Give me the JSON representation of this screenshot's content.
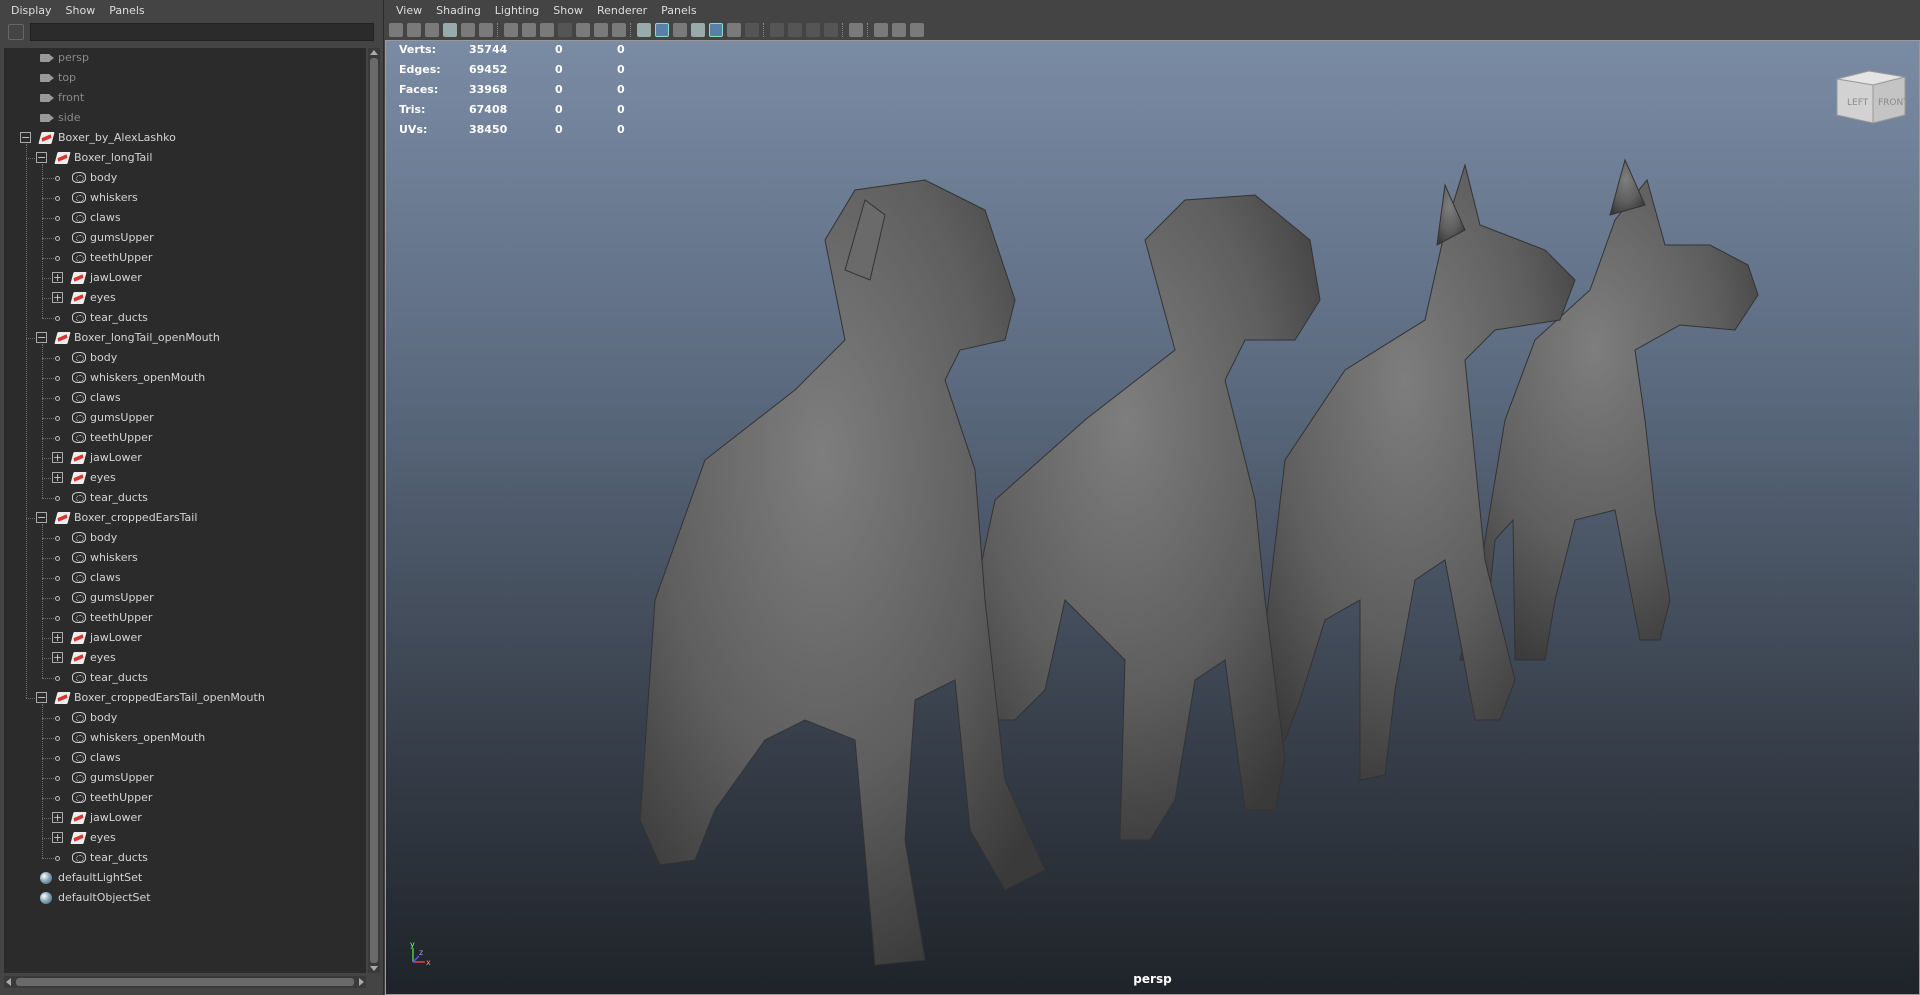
{
  "outliner": {
    "menu": [
      "Display",
      "Show",
      "Panels"
    ],
    "items": [
      {
        "label": "persp",
        "type": "camera",
        "level": 0
      },
      {
        "label": "top",
        "type": "camera",
        "level": 0
      },
      {
        "label": "front",
        "type": "camera",
        "level": 0
      },
      {
        "label": "side",
        "type": "camera",
        "level": 0
      },
      {
        "label": "Boxer_by_AlexLashko",
        "type": "group",
        "level": 0,
        "expand": "minus"
      },
      {
        "label": "Boxer_longTail",
        "type": "group",
        "level": 1,
        "expand": "minus"
      },
      {
        "label": "body",
        "type": "mesh",
        "level": 2
      },
      {
        "label": "whiskers",
        "type": "mesh",
        "level": 2
      },
      {
        "label": "claws",
        "type": "mesh",
        "level": 2
      },
      {
        "label": "gumsUpper",
        "type": "mesh",
        "level": 2
      },
      {
        "label": "teethUpper",
        "type": "mesh",
        "level": 2
      },
      {
        "label": "jawLower",
        "type": "group",
        "level": 2,
        "expand": "plus"
      },
      {
        "label": "eyes",
        "type": "group",
        "level": 2,
        "expand": "plus"
      },
      {
        "label": "tear_ducts",
        "type": "mesh",
        "level": 2
      },
      {
        "label": "Boxer_longTail_openMouth",
        "type": "group",
        "level": 1,
        "expand": "minus"
      },
      {
        "label": "body",
        "type": "mesh",
        "level": 2
      },
      {
        "label": "whiskers_openMouth",
        "type": "mesh",
        "level": 2
      },
      {
        "label": "claws",
        "type": "mesh",
        "level": 2
      },
      {
        "label": "gumsUpper",
        "type": "mesh",
        "level": 2
      },
      {
        "label": "teethUpper",
        "type": "mesh",
        "level": 2
      },
      {
        "label": "jawLower",
        "type": "group",
        "level": 2,
        "expand": "plus"
      },
      {
        "label": "eyes",
        "type": "group",
        "level": 2,
        "expand": "plus"
      },
      {
        "label": "tear_ducts",
        "type": "mesh",
        "level": 2
      },
      {
        "label": "Boxer_croppedEarsTail",
        "type": "group",
        "level": 1,
        "expand": "minus"
      },
      {
        "label": "body",
        "type": "mesh",
        "level": 2
      },
      {
        "label": "whiskers",
        "type": "mesh",
        "level": 2
      },
      {
        "label": "claws",
        "type": "mesh",
        "level": 2
      },
      {
        "label": "gumsUpper",
        "type": "mesh",
        "level": 2
      },
      {
        "label": "teethUpper",
        "type": "mesh",
        "level": 2
      },
      {
        "label": "jawLower",
        "type": "group",
        "level": 2,
        "expand": "plus"
      },
      {
        "label": "eyes",
        "type": "group",
        "level": 2,
        "expand": "plus"
      },
      {
        "label": "tear_ducts",
        "type": "mesh",
        "level": 2
      },
      {
        "label": "Boxer_croppedEarsTail_openMouth",
        "type": "group",
        "level": 1,
        "expand": "minus"
      },
      {
        "label": "body",
        "type": "mesh",
        "level": 2
      },
      {
        "label": "whiskers_openMouth",
        "type": "mesh",
        "level": 2
      },
      {
        "label": "claws",
        "type": "mesh",
        "level": 2
      },
      {
        "label": "gumsUpper",
        "type": "mesh",
        "level": 2
      },
      {
        "label": "teethUpper",
        "type": "mesh",
        "level": 2
      },
      {
        "label": "jawLower",
        "type": "group",
        "level": 2,
        "expand": "plus"
      },
      {
        "label": "eyes",
        "type": "group",
        "level": 2,
        "expand": "plus"
      },
      {
        "label": "tear_ducts",
        "type": "mesh",
        "level": 2
      },
      {
        "label": "defaultLightSet",
        "type": "set",
        "level": 0
      },
      {
        "label": "defaultObjectSet",
        "type": "set",
        "level": 0
      }
    ]
  },
  "viewport": {
    "menu": [
      "View",
      "Shading",
      "Lighting",
      "Show",
      "Renderer",
      "Panels"
    ],
    "hud": [
      {
        "name": "Verts:",
        "v1": "35744",
        "v2": "0",
        "v3": "0"
      },
      {
        "name": "Edges:",
        "v1": "69452",
        "v2": "0",
        "v3": "0"
      },
      {
        "name": "Faces:",
        "v1": "33968",
        "v2": "0",
        "v3": "0"
      },
      {
        "name": "Tris:",
        "v1": "67408",
        "v2": "0",
        "v3": "0"
      },
      {
        "name": "UVs:",
        "v1": "38450",
        "v2": "0",
        "v3": "0"
      }
    ],
    "camera_label": "persp",
    "viewcube": {
      "left": "LEFT",
      "front": "FRONT"
    },
    "axis": {
      "y": "y",
      "x": "x",
      "z": "z"
    }
  },
  "colors": {
    "viewport_top": "#7a8ba4",
    "viewport_bottom": "#1f2329",
    "panel_bg": "#444444",
    "tree_bg": "#2b2b2b",
    "mesh_gray": "#6e6e6e"
  }
}
